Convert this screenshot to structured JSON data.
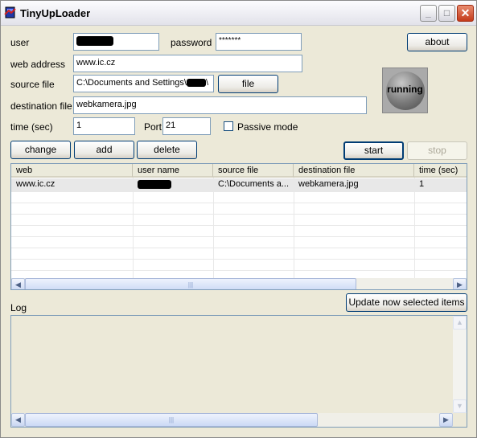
{
  "window": {
    "title": "TinyUpLoader",
    "minimize_icon": "minimize-icon",
    "maximize_icon": "maximize-icon",
    "close_icon": "close-icon"
  },
  "form": {
    "user_label": "user",
    "user_value": "",
    "password_label": "password",
    "password_value": "*******",
    "web_address_label": "web address",
    "web_address_value": "www.ic.cz",
    "source_file_label": "source file",
    "source_file_value": "C:\\Documents and Settings\\",
    "source_file_suffix": "\\",
    "file_button": "file",
    "destination_file_label": "destination file",
    "destination_file_value": "webkamera.jpg",
    "time_label": "time (sec)",
    "time_value": "1",
    "port_label": "Port",
    "port_value": "21",
    "passive_label": "Passive mode",
    "passive_checked": false
  },
  "about_button": "about",
  "status_indicator": "running",
  "actions": {
    "change": "change",
    "add": "add",
    "delete": "delete",
    "start": "start",
    "stop": "stop"
  },
  "table": {
    "columns": [
      "web",
      "user name",
      "source file",
      "destination file",
      "time (sec)"
    ],
    "rows": [
      {
        "web": "www.ic.cz",
        "user_name": "",
        "source_file": "C:\\Documents a...",
        "destination_file": "webkamera.jpg",
        "time": "1"
      }
    ]
  },
  "log_label": "Log",
  "update_button": "Update now selected items",
  "colors": {
    "accent_border": "#003c74",
    "field_border": "#7f9db9",
    "window_bg": "#ece9d8"
  }
}
